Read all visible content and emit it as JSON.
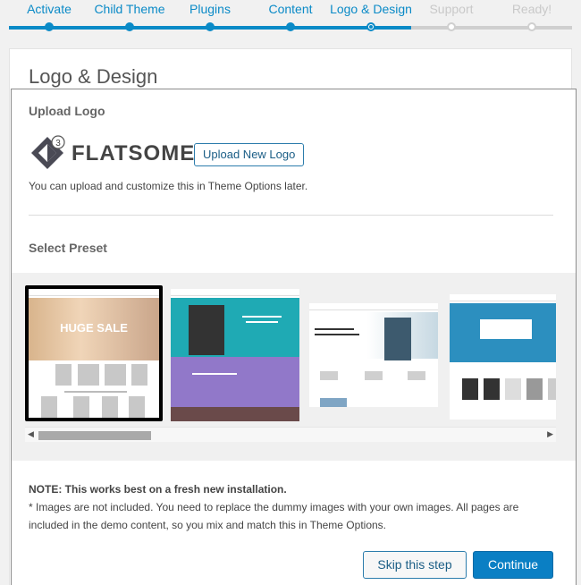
{
  "steps": [
    {
      "label": "Activate",
      "state": "done"
    },
    {
      "label": "Child Theme",
      "state": "done"
    },
    {
      "label": "Plugins",
      "state": "done"
    },
    {
      "label": "Content",
      "state": "done"
    },
    {
      "label": "Logo & Design",
      "state": "active"
    },
    {
      "label": "Support",
      "state": "todo"
    },
    {
      "label": "Ready!",
      "state": "todo"
    }
  ],
  "colors": {
    "accent": "#0a8ac7",
    "inactive": "#cfcfcf"
  },
  "page": {
    "title": "Logo & Design"
  },
  "upload": {
    "heading": "Upload Logo",
    "logo_text": "FLATSOME",
    "logo_badge": "3",
    "button_label": "Upload New Logo",
    "hint": "You can upload and customize this in Theme Options later."
  },
  "preset": {
    "heading": "Select Preset",
    "items": [
      {
        "name": "preset-huge-sale",
        "hero_text": "HUGE SALE",
        "selected": true
      },
      {
        "name": "preset-saxophone",
        "hero_text": "",
        "selected": false
      },
      {
        "name": "preset-corporate",
        "hero_text": "",
        "selected": false
      },
      {
        "name": "preset-shop",
        "hero_text": "",
        "selected": false
      }
    ]
  },
  "note": {
    "title": "NOTE: This works best on a fresh new installation.",
    "body": "* Images are not included. You need to replace the dummy images with your own images. All pages are included in the demo content, so you mix and match this in Theme Options."
  },
  "actions": {
    "skip_label": "Skip this step",
    "continue_label": "Continue"
  },
  "icons": [
    "logo-mark-icon",
    "scroll-left-icon",
    "scroll-right-icon"
  ]
}
